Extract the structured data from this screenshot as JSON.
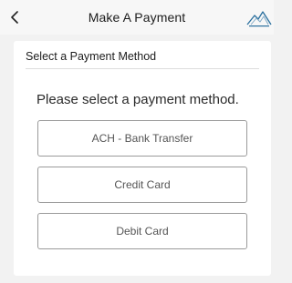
{
  "header": {
    "title": "Make A Payment",
    "back_icon": "chevron-left-icon",
    "logo_icon": "mountain-logo-icon"
  },
  "section": {
    "title": "Select a Payment Method",
    "prompt": "Please select a payment method."
  },
  "payment_methods": [
    {
      "label": "ACH - Bank Transfer"
    },
    {
      "label": "Credit Card"
    },
    {
      "label": "Debit Card"
    }
  ],
  "colors": {
    "background": "#f2f2f2",
    "card": "#ffffff",
    "button_border": "#9a9a9a",
    "button_text": "#555555",
    "logo": "#2a6f9e"
  }
}
